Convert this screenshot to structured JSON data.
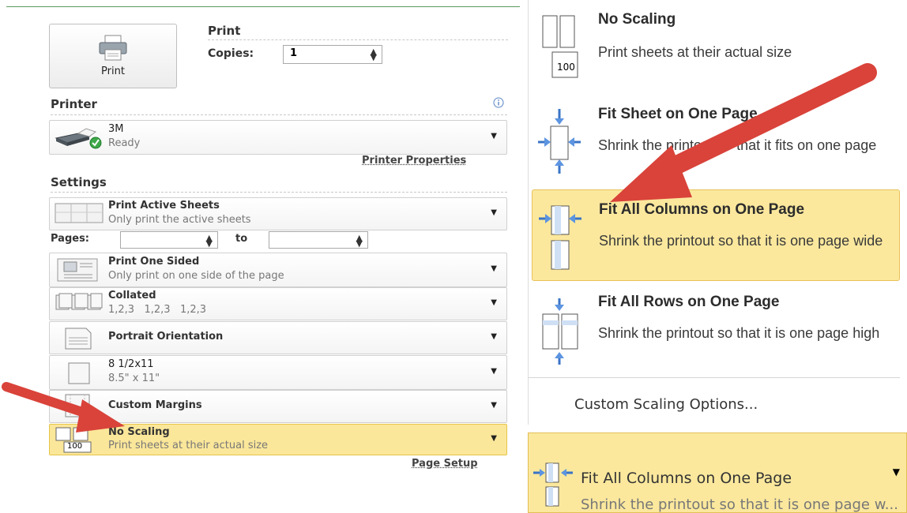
{
  "left": {
    "print_section": {
      "title": "Print",
      "button_label": "Print",
      "copies_label": "Copies:",
      "copies_value": "1"
    },
    "printer_section": {
      "title": "Printer",
      "printer_name": "3M",
      "printer_status": "Ready",
      "properties_link": "Printer Properties"
    },
    "settings_section": {
      "title": "Settings",
      "active_sheets": {
        "title": "Print Active Sheets",
        "desc": "Only print the active sheets"
      },
      "pages": {
        "label": "Pages:",
        "to_label": "to",
        "from_value": "",
        "to_value": ""
      },
      "sided": {
        "title": "Print One Sided",
        "desc": "Only print on one side of the page"
      },
      "collated": {
        "title": "Collated",
        "desc": "1,2,3   1,2,3   1,2,3"
      },
      "orientation": {
        "title": "Portrait Orientation"
      },
      "paper": {
        "title": "8 1/2x11",
        "desc": "8.5\" x 11\""
      },
      "margins": {
        "title": "Custom Margins"
      },
      "scaling": {
        "title": "No Scaling",
        "desc": "Print sheets at their actual size",
        "icon_number": "100"
      },
      "page_setup_link": "Page Setup"
    }
  },
  "scaling_menu": {
    "items": [
      {
        "title": "No Scaling",
        "desc": "Print sheets at their actual size",
        "icon_number": "100"
      },
      {
        "title": "Fit Sheet on One Page",
        "desc": "Shrink the printout so that it fits on one page"
      },
      {
        "title": "Fit All Columns on One Page",
        "desc": "Shrink the printout so that it is one page wide"
      },
      {
        "title": "Fit All Rows on One Page",
        "desc": "Shrink the printout so that it is one page high"
      }
    ],
    "custom_label": "Custom Scaling Options..."
  },
  "selected_dropdown": {
    "title": "Fit All Columns on One Page",
    "desc": "Shrink the printout so that it is one page w..."
  },
  "colors": {
    "highlight": "#fbe89d",
    "arrow": "#d9433a",
    "accent_border": "#e8c15a"
  }
}
